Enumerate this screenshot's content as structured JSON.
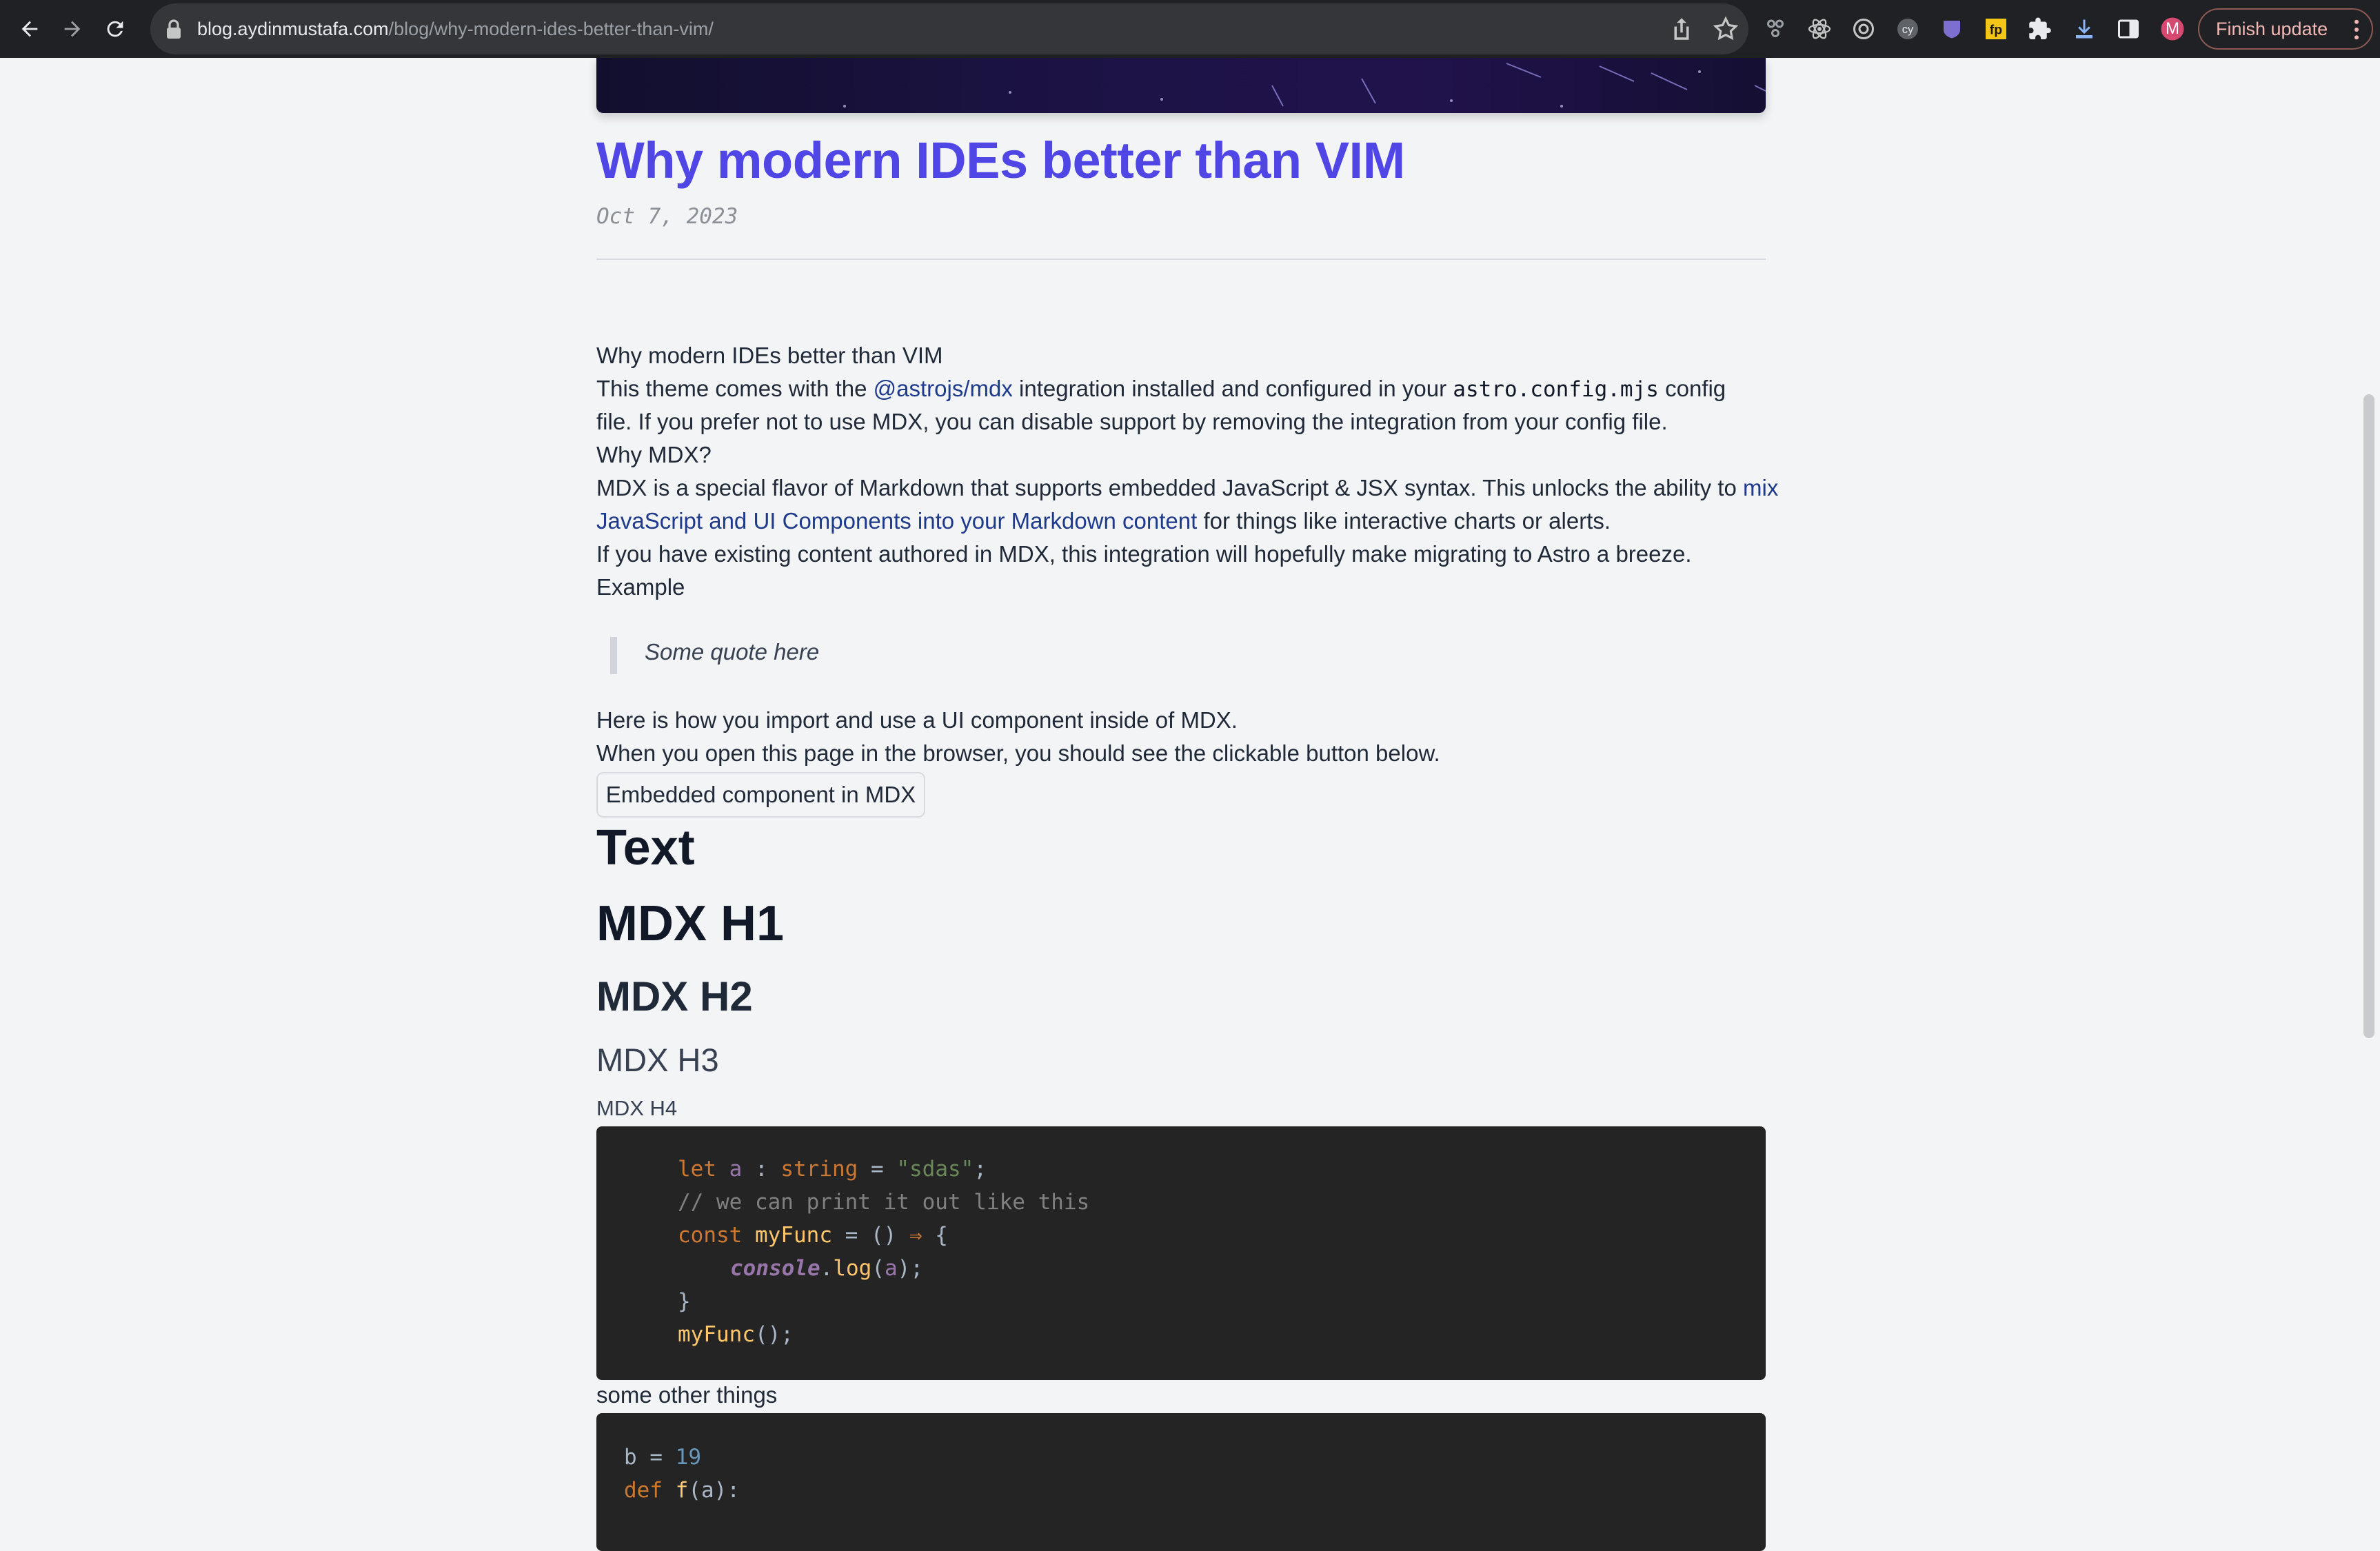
{
  "browser": {
    "url_host": "blog.aydinmustafa.com",
    "url_path": "/blog/why-modern-ides-better-than-vim/",
    "finish_update_label": "Finish update",
    "profile_initial": "M",
    "extensions": [
      "graph-ext-icon",
      "react-devtools-icon",
      "target-ext-icon",
      "cy-ext-icon",
      "shield-ext-icon",
      "fp-ext-icon",
      "puzzle-icon",
      "download-icon",
      "side-panel-icon"
    ]
  },
  "post": {
    "title": "Why modern IDEs better than VIM",
    "date": "Oct 7, 2023"
  },
  "content": {
    "p1": "Why modern IDEs better than VIM",
    "p2_a": "This theme comes with the ",
    "p2_link": "@astrojs/mdx",
    "p2_b": " integration installed and configured in your ",
    "p2_code": "astro.config.mjs",
    "p2_c": " config",
    "p3": "file. If you prefer not to use MDX, you can disable support by removing the integration from your config file.",
    "p4": "Why MDX?",
    "p5_a": "MDX is a special flavor of Markdown that supports embedded JavaScript & JSX syntax. This unlocks the ability to ",
    "p5_link1": "mix",
    "p6_link2": "JavaScript and UI Components into your Markdown content",
    "p6_b": " for things like interactive charts or alerts.",
    "p7": "If you have existing content authored in MDX, this integration will hopefully make migrating to Astro a breeze.",
    "p8": "Example",
    "quote": "Some quote here",
    "p9": "Here is how you import and use a UI component inside of MDX.",
    "p10": "When you open this page in the browser, you should see the clickable button below.",
    "embed_button": "Embedded component in MDX",
    "h_text": "Text",
    "h1": "MDX H1",
    "h2": "MDX H2",
    "h3": "MDX H3",
    "h4": "MDX H4",
    "between_code": "some other things"
  },
  "code1": {
    "l1_kw": "let",
    "l1_var": "a",
    "l1_colon": " : ",
    "l1_type": "string",
    "l1_eq": " = ",
    "l1_str": "\"sdas\"",
    "l1_end": ";",
    "l2": "// we can print it out like this",
    "l3_kw": "const",
    "l3_fn": "myFunc",
    "l3_rest": " = () ",
    "l3_arrow": "⇒",
    "l3_brace": " {",
    "l4_obj": "console",
    "l4_dot": ".",
    "l4_fn": "log",
    "l4_open": "(",
    "l4_arg": "a",
    "l4_close": ");",
    "l5": "}",
    "l6_fn": "myFunc",
    "l6_rest": "();"
  },
  "code2": {
    "l1_var": "b",
    "l1_eq": " = ",
    "l1_num": "19",
    "l2_kw": "def",
    "l2_fn": "f",
    "l2_rest": "(a):"
  }
}
